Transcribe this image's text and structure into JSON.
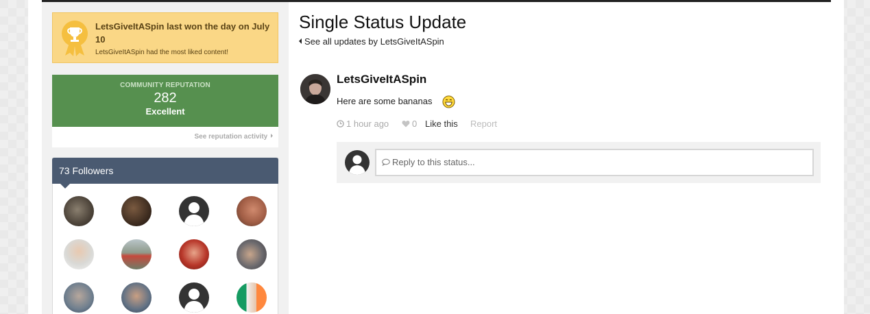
{
  "sidebar": {
    "winner": {
      "title": "LetsGiveItASpin last won the day on July 10",
      "subtitle": "LetsGiveItASpin had the most liked content!"
    },
    "reputation": {
      "label": "COMMUNITY REPUTATION",
      "value": "282",
      "level": "Excellent",
      "link": "See reputation activity"
    },
    "followers": {
      "title": "73 Followers"
    }
  },
  "main": {
    "title": "Single Status Update",
    "see_all": "See all updates by LetsGiveItASpin",
    "post": {
      "author": "LetsGiveItASpin",
      "body": "Here are some bananas",
      "time": "1 hour ago",
      "likes": "0",
      "like_label": "Like this",
      "report_label": "Report"
    },
    "reply": {
      "placeholder": "Reply to this status..."
    }
  },
  "colors": {
    "winner_bg": "#fad786",
    "reputation_bg": "#56904f",
    "followers_header_bg": "#4a5a71"
  }
}
